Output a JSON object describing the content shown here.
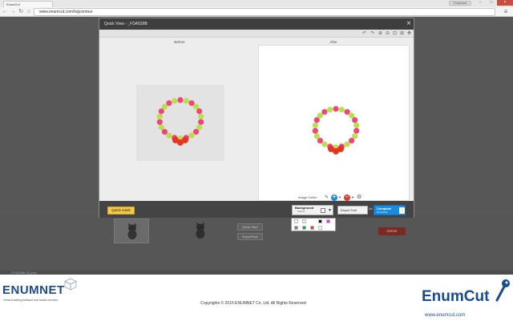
{
  "browser": {
    "tab_title": "EnumCut",
    "user_label": "Customer",
    "url": "www.enumcut.com/logcontour",
    "window_buttons": [
      "–",
      "□",
      "×"
    ]
  },
  "dialog": {
    "title": "Quick View - _FDA039B",
    "before_label": "Before",
    "after_label": "After",
    "image_cutter_label": "Image Cutter",
    "footer": {
      "quick_mask": "Quick mask",
      "background_label": "Background",
      "background_sub": "Setting",
      "export_tool": "Export Tool",
      "complete_label": "Complete",
      "complete_sub": "Download"
    }
  },
  "background_swatches": {
    "colors": [
      "#ffffff",
      "#eeeeee",
      "#111111",
      "#ff2bd6",
      "#7a7a7a",
      "#1f9e4a",
      "#e53935",
      "#fafafa"
    ]
  },
  "page_behind": {
    "quick_start": "Quick Start",
    "export_tool": "ExportTool",
    "delete": "Delete",
    "status_file": "_FDA039B (2).png"
  },
  "footer": {
    "left_logo": "ENUMNET",
    "left_tagline": "Great enabling software and useful services.",
    "copyright": "Copyrights © 2015 ENUMNET Co. Ltd. All Rights Reserved",
    "right_logo": "EnumCut",
    "right_url": "www.enumcut.com"
  }
}
